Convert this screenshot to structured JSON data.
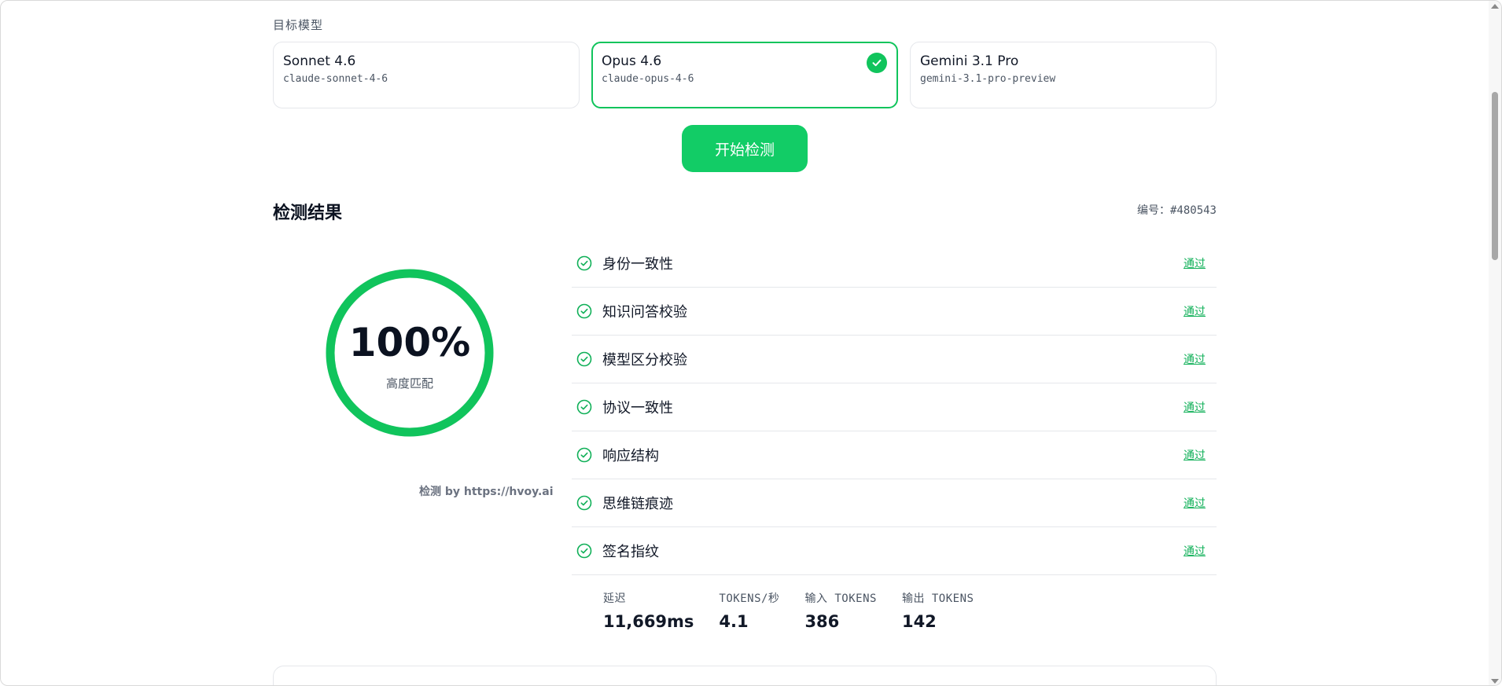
{
  "target": {
    "label": "目标模型",
    "models": [
      {
        "name": "Sonnet 4.6",
        "id": "claude-sonnet-4-6",
        "selected": false
      },
      {
        "name": "Opus 4.6",
        "id": "claude-opus-4-6",
        "selected": true
      },
      {
        "name": "Gemini 3.1 Pro",
        "id": "gemini-3.1-pro-preview",
        "selected": false
      }
    ],
    "start_label": "开始检测"
  },
  "result": {
    "title": "检测结果",
    "id": "编号：#480543",
    "score": "100%",
    "score_fraction": 1.0,
    "score_label": "高度匹配",
    "detect_by": "检测 by https://hvoy.ai",
    "checks": [
      {
        "name": "身份一致性",
        "status": "通过"
      },
      {
        "name": "知识问答校验",
        "status": "通过"
      },
      {
        "name": "模型区分校验",
        "status": "通过"
      },
      {
        "name": "协议一致性",
        "status": "通过"
      },
      {
        "name": "响应结构",
        "status": "通过"
      },
      {
        "name": "思维链痕迹",
        "status": "通过"
      },
      {
        "name": "签名指纹",
        "status": "通过"
      }
    ],
    "stats": [
      {
        "label": "延迟",
        "value": "11,669ms"
      },
      {
        "label": "TOKENS/秒",
        "value": "4.1"
      },
      {
        "label": "输入 TOKENS",
        "value": "386"
      },
      {
        "label": "输出 TOKENS",
        "value": "142"
      }
    ]
  },
  "colors": {
    "accent": "#12cc66",
    "ring": "#10c45c",
    "pass": "#10b058"
  },
  "icons": {
    "selected": "check-circle-icon",
    "check": "check-circle-outline-icon"
  }
}
